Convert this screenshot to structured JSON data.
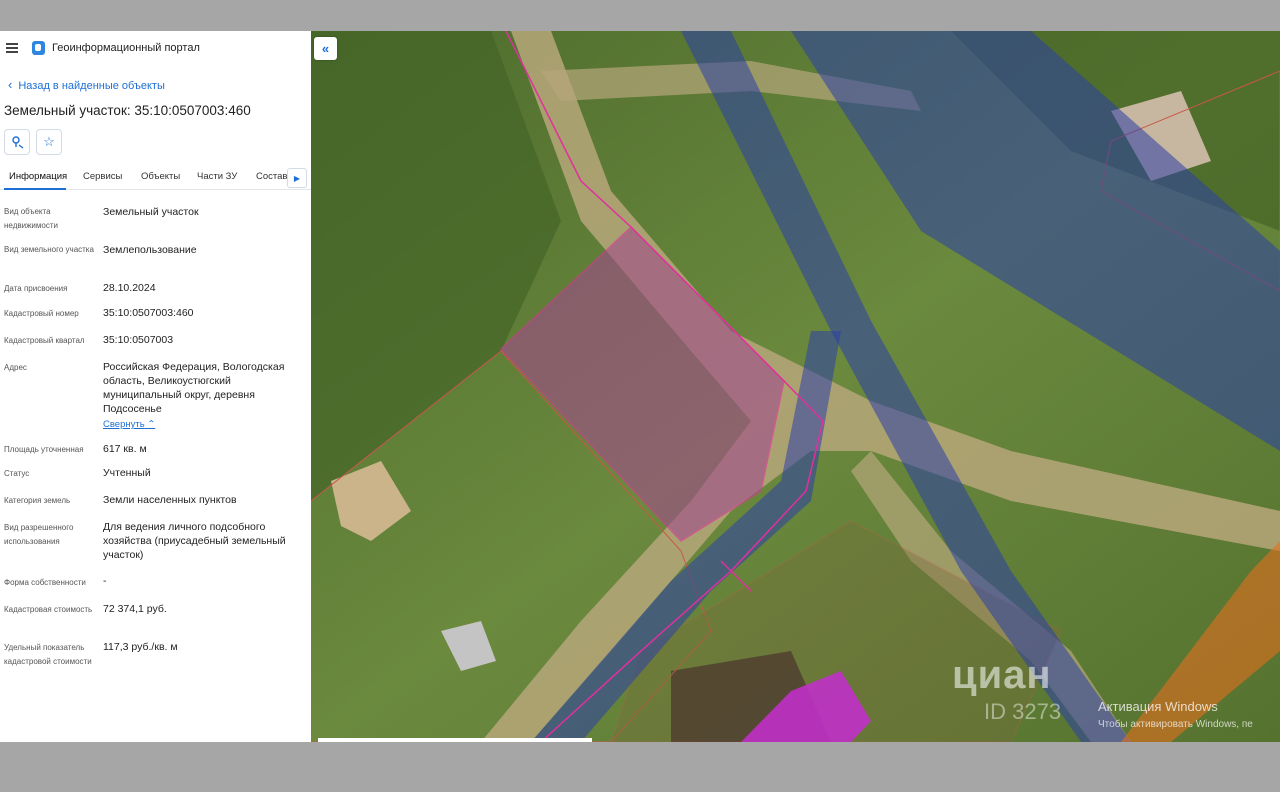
{
  "header": {
    "portal_title": "Геоинформационный портал"
  },
  "nav": {
    "back_label": "Назад в найденные объекты"
  },
  "object": {
    "title": "Земельный участок: 35:10:0507003:460"
  },
  "tabs": [
    "Информация",
    "Сервисы",
    "Объекты",
    "Части ЗУ",
    "Состав"
  ],
  "attributes": [
    {
      "label": "Вид объекта недвижимости",
      "value": "Земельный участок"
    },
    {
      "label": "Вид земельного участка",
      "value": "Землепользование"
    },
    {
      "label": "Дата присвоения",
      "value": "28.10.2024"
    },
    {
      "label": "Кадастровый номер",
      "value": "35:10:0507003:460"
    },
    {
      "label": "Кадастровый квартал",
      "value": "35:10:0507003"
    },
    {
      "label": "Адрес",
      "value": "Российская Федерация, Вологодская область, Великоустюгский муниципальный округ, деревня Подсосенье"
    },
    {
      "label": "Площадь уточненная",
      "value": "617 кв. м"
    },
    {
      "label": "Статус",
      "value": "Учтенный"
    },
    {
      "label": "Категория земель",
      "value": "Земли населенных пунктов"
    },
    {
      "label": "Вид разрешенного использования",
      "value": "Для ведения личного подсобного хозяйства (приусадебный земельный участок)"
    },
    {
      "label": "Форма собственности",
      "value": "-"
    },
    {
      "label": "Кадастровая стоимость",
      "value": "72 374,1 руб."
    },
    {
      "label": "Удельный показатель кадастровой стоимости",
      "value": "117,3 руб./кв. м"
    }
  ],
  "address_collapse_label": "Свернуть",
  "icons": {
    "menu": "hamburger-icon",
    "logo": "portal-logo-icon",
    "back": "chevron-left-icon",
    "locate": "locate-parcel-icon",
    "favorite": "star-icon",
    "tabs_more": "chevron-right-icon",
    "collapse_panel": "double-chevron-left-icon"
  },
  "watermark": {
    "brand": "циан",
    "id_text": "ID 3273"
  },
  "windows_activation": {
    "line1": "Активация Windows",
    "line2": "Чтобы активировать Windows, пе"
  },
  "colors": {
    "accent": "#1d6fd6",
    "parcel_fill": "#a24b8c",
    "parcel_border": "#e0309e",
    "zone_blue": "#2b3fa8",
    "zone_orange": "#e2701f",
    "building_magenta": "#c030c8"
  }
}
